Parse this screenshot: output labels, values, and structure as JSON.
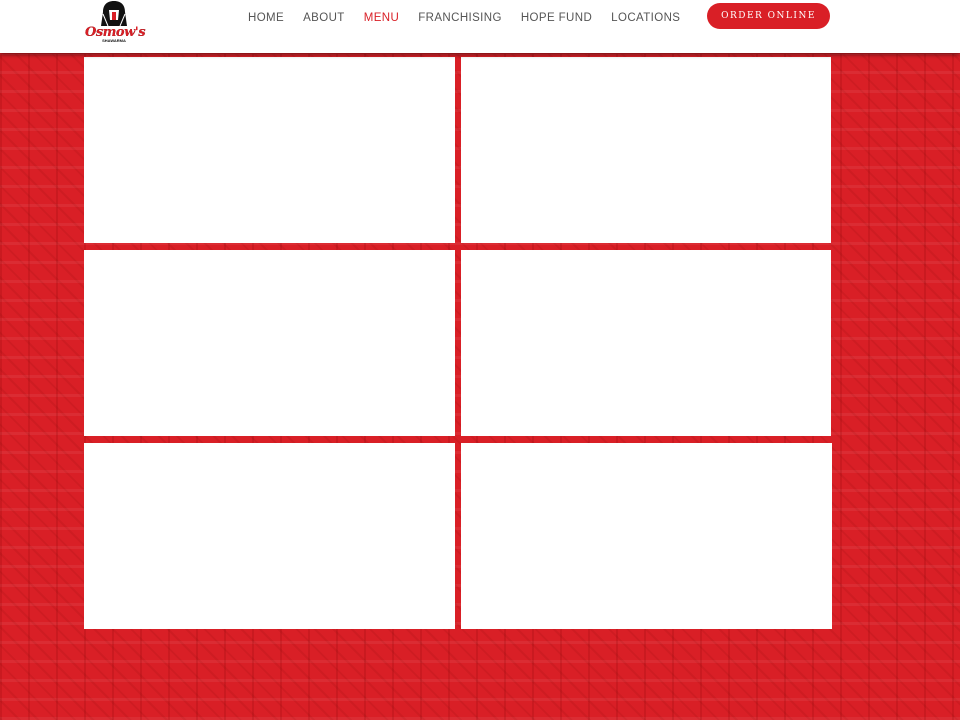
{
  "brand": {
    "name": "Osmow's",
    "sub": "SHAWARMA",
    "logo_icon": "pharaoh-head-icon",
    "color": "#d91f26"
  },
  "nav": {
    "items": [
      {
        "label": "HOME"
      },
      {
        "label": "ABOUT"
      },
      {
        "label": "MENU",
        "active": true
      },
      {
        "label": "FRANCHISING"
      },
      {
        "label": "HOPE FUND"
      },
      {
        "label": "LOCATIONS"
      }
    ],
    "active_color": "#d91f26"
  },
  "order_button": {
    "label": "ORDER ONLINE"
  },
  "menu_grid": {
    "cards": [
      {},
      {},
      {},
      {},
      {},
      {}
    ]
  }
}
